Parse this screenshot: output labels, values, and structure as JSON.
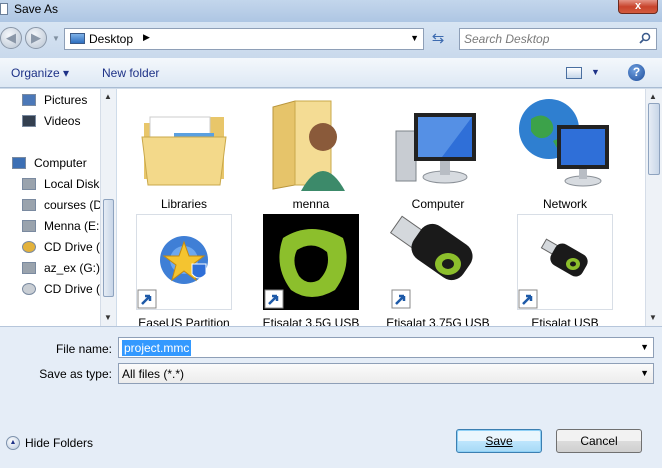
{
  "window": {
    "title": "Save As",
    "close_label": "x"
  },
  "nav": {
    "back_glyph": "◀",
    "forward_glyph": "▶",
    "address_text": "Desktop",
    "address_arrow": "▶",
    "dropdown_glyph": "▼",
    "refresh_glyph": "⇆",
    "search_placeholder": "Search Desktop"
  },
  "toolbar": {
    "organize_label": "Organize ▾",
    "new_folder_label": "New folder",
    "views_drop": "▼",
    "help_label": "?"
  },
  "sidebar": {
    "items": [
      {
        "label": "Pictures",
        "icon": "pictures-icon",
        "color": "#4b78b8"
      },
      {
        "label": "Videos",
        "icon": "videos-icon",
        "color": "#333f4f"
      },
      {
        "label": "Computer",
        "icon": "computer-icon",
        "color": "#3c6fb4"
      },
      {
        "label": "Local Disk",
        "icon": "drive-icon",
        "color": "#9aa3ad"
      },
      {
        "label": "courses (D",
        "icon": "drive-icon",
        "color": "#9aa3ad"
      },
      {
        "label": "Menna (E:",
        "icon": "drive-icon",
        "color": "#9aa3ad"
      },
      {
        "label": "CD Drive (",
        "icon": "cd-drive-icon",
        "color": "#e3b23c"
      },
      {
        "label": "az_ex (G:)",
        "icon": "drive-icon",
        "color": "#9aa3ad"
      },
      {
        "label": "CD Drive (",
        "icon": "cd-drive-icon",
        "color": "#c9ced4"
      }
    ]
  },
  "files": [
    {
      "name": "Libraries",
      "icon": "libraries-folder-icon",
      "shortcut": false
    },
    {
      "name": "menna",
      "icon": "user-folder-icon",
      "shortcut": false
    },
    {
      "name": "Computer",
      "icon": "computer-icon",
      "shortcut": false
    },
    {
      "name": "Network",
      "icon": "network-icon",
      "shortcut": false
    },
    {
      "name": "EaseUS Partition",
      "icon": "easeus-icon",
      "shortcut": true
    },
    {
      "name": "Etisalat 3.5G USB",
      "icon": "etisalat-logo-icon",
      "shortcut": true
    },
    {
      "name": "Etisalat 3.75G USB",
      "icon": "usb-modem-icon",
      "shortcut": true
    },
    {
      "name": "Etisalat USB",
      "icon": "usb-modem-icon",
      "shortcut": true
    }
  ],
  "form": {
    "file_name_label": "File name:",
    "file_name_value": "project.mmc",
    "save_type_label": "Save as type:",
    "save_type_value": "All files (*.*)"
  },
  "footer": {
    "hide_folders_label": "Hide Folders",
    "hide_folders_glyph": "▲",
    "save_label": "Save",
    "cancel_label": "Cancel"
  }
}
